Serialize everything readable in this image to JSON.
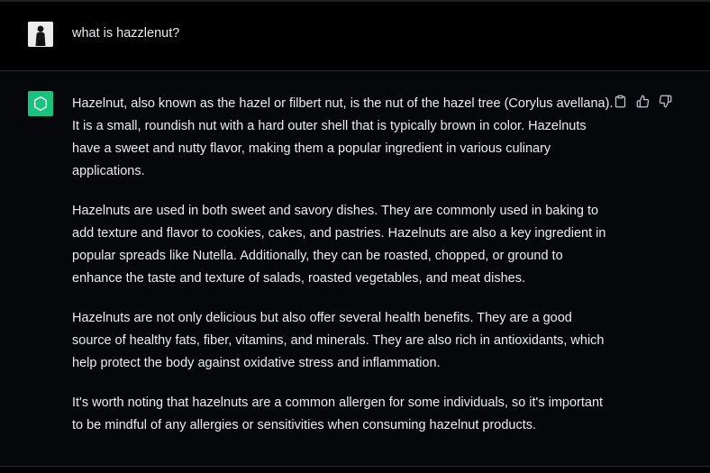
{
  "colors": {
    "page_bg": "#000000",
    "assistant_bg": "#05070a",
    "bot_avatar": "#19c37d",
    "text": "#ececf1",
    "icon": "#c5c5d2"
  },
  "user_message": {
    "text": "what is hazzlenut?"
  },
  "assistant_message": {
    "paragraphs": [
      {
        "lines": [
          "Hazelnut, also known as the hazel or filbert nut, is the nut of the hazel tree (Corylus avellana).",
          "It is a small, roundish nut with a hard outer shell that is typically brown in color. Hazelnuts",
          "have a sweet and nutty flavor, making them a popular ingredient in various culinary",
          "applications."
        ]
      },
      {
        "lines": [
          "Hazelnuts are used in both sweet and savory dishes. They are commonly used in baking to",
          "add texture and flavor to cookies, cakes, and pastries. Hazelnuts are also a key ingredient in",
          "popular spreads like Nutella. Additionally, they can be roasted, chopped, or ground to",
          "enhance the taste and texture of salads, roasted vegetables, and meat dishes."
        ]
      },
      {
        "lines": [
          "Hazelnuts are not only delicious but also offer several health benefits. They are a good",
          "source of healthy fats, fiber, vitamins, and minerals. They are also rich in antioxidants, which",
          "help protect the body against oxidative stress and inflammation."
        ]
      },
      {
        "lines": [
          "It's worth noting that hazelnuts are a common allergen for some individuals, so it's important",
          "to be mindful of any allergies or sensitivities when consuming hazelnut products."
        ]
      }
    ]
  },
  "icons": {
    "user_avatar": "user-avatar-photo",
    "bot_avatar": "openai-logo-icon",
    "copy": "clipboard-icon",
    "like": "thumbs-up-icon",
    "dislike": "thumbs-down-icon"
  }
}
